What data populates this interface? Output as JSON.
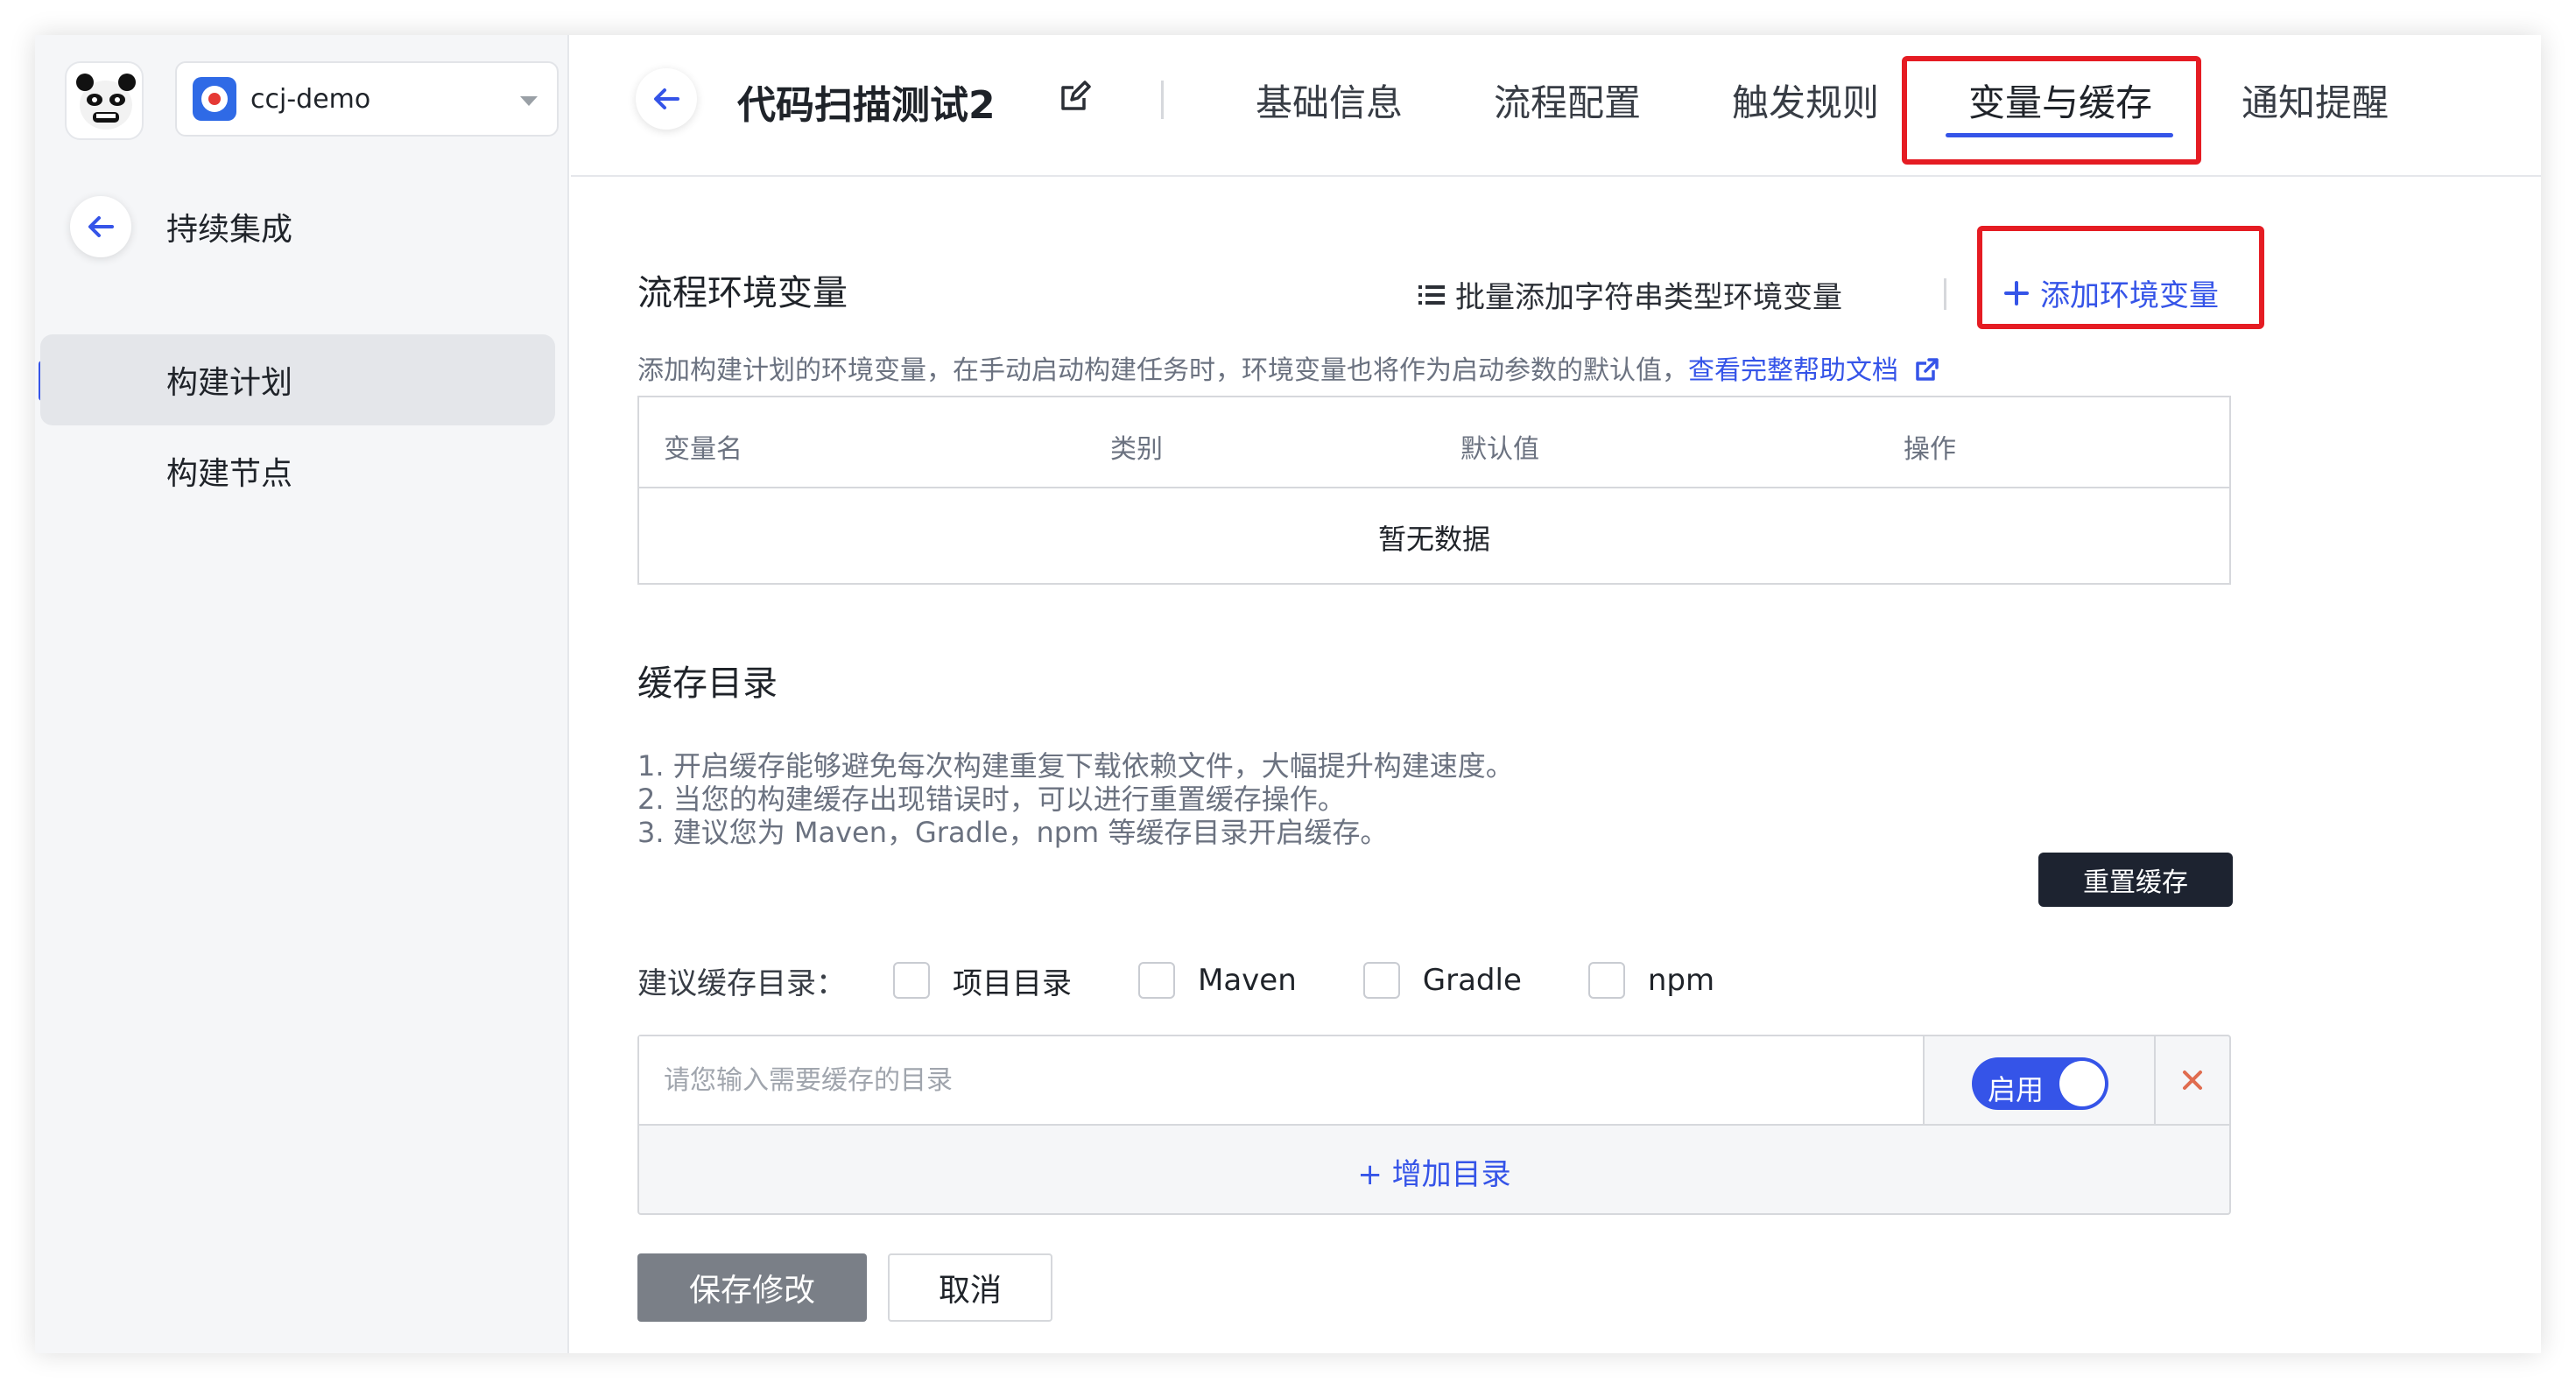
{
  "sidebar": {
    "project_name": "ccj-demo",
    "back_label": "持续集成",
    "items": [
      {
        "label": "构建计划",
        "active": true
      },
      {
        "label": "构建节点",
        "active": false
      }
    ]
  },
  "header": {
    "title": "代码扫描测试2",
    "tabs": [
      {
        "label": "基础信息"
      },
      {
        "label": "流程配置"
      },
      {
        "label": "触发规则"
      },
      {
        "label": "变量与缓存",
        "active": true
      },
      {
        "label": "通知提醒"
      }
    ]
  },
  "env": {
    "title": "流程环境变量",
    "batch_add_label": "批量添加字符串类型环境变量",
    "add_label": "添加环境变量",
    "description": "添加构建计划的环境变量，在手动启动构建任务时，环境变量也将作为启动参数的默认值，",
    "help_link": "查看完整帮助文档",
    "columns": [
      "变量名",
      "类别",
      "默认值",
      "操作"
    ],
    "empty_text": "暂无数据"
  },
  "cache": {
    "title": "缓存目录",
    "tips": [
      "1. 开启缓存能够避免每次构建重复下载依赖文件，大幅提升构建速度。",
      "2. 当您的构建缓存出现错误时，可以进行重置缓存操作。",
      "3. 建议您为 Maven，Gradle，npm 等缓存目录开启缓存。"
    ],
    "reset_label": "重置缓存",
    "suggest_label": "建议缓存目录：",
    "options": [
      "项目目录",
      "Maven",
      "Gradle",
      "npm"
    ],
    "input_placeholder": "请您输入需要缓存的目录",
    "toggle_label": "启用",
    "toggle_on": true,
    "add_dir_label": "+ 增加目录"
  },
  "footer": {
    "save_label": "保存修改",
    "cancel_label": "取消"
  },
  "colors": {
    "accent": "#3554e8",
    "highlight": "#e51c23",
    "danger": "#e06c4f"
  }
}
